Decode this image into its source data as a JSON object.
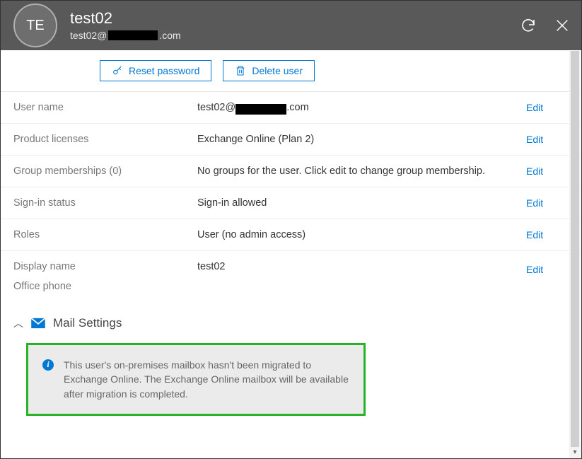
{
  "header": {
    "avatar_initials": "TE",
    "title": "test02",
    "email_prefix": "test02@",
    "email_suffix": ".com"
  },
  "toolbar": {
    "reset_label": "Reset password",
    "delete_label": "Delete user"
  },
  "rows": {
    "username_label": "User name",
    "username_prefix": "test02@",
    "username_suffix": ".com",
    "licenses_label": "Product licenses",
    "licenses_value": "Exchange Online (Plan 2)",
    "groups_label": "Group memberships (0)",
    "groups_value": "No groups for the user. Click edit to change group membership.",
    "signin_label": "Sign-in status",
    "signin_value": "Sign-in allowed",
    "roles_label": "Roles",
    "roles_value": "User (no admin access)",
    "display_label": "Display name",
    "display_value": "test02",
    "phone_label": "Office phone",
    "phone_value": "",
    "edit": "Edit"
  },
  "section": {
    "title": "Mail Settings"
  },
  "info": {
    "text": "This user's on-premises mailbox hasn't been migrated to Exchange Online. The Exchange Online mailbox will be available after migration is completed."
  }
}
